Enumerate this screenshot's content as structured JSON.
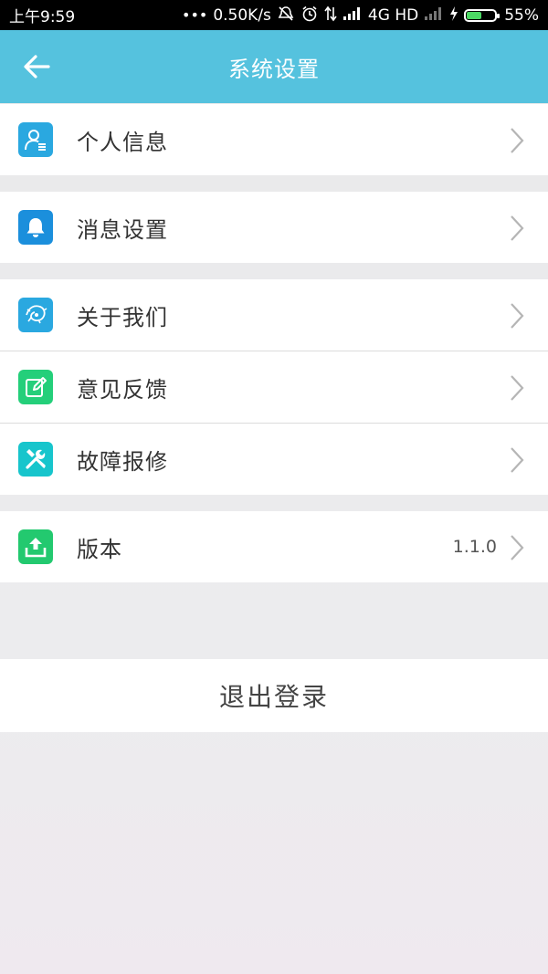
{
  "status_bar": {
    "time": "上午9:59",
    "network_speed": "0.50K/s",
    "network_type": "4G HD",
    "battery_percent": "55%",
    "battery_level": 0.55
  },
  "app_bar": {
    "title": "系统设置",
    "back_icon": "arrow-left-icon"
  },
  "groups": [
    {
      "items": [
        {
          "label": "个人信息",
          "icon": "user-profile-icon",
          "icon_color": "#2aa8e0",
          "value": ""
        }
      ]
    },
    {
      "items": [
        {
          "label": "消息设置",
          "icon": "bell-icon",
          "icon_color": "#1b8fdc",
          "value": ""
        }
      ]
    },
    {
      "items": [
        {
          "label": "关于我们",
          "icon": "about-logo-icon",
          "icon_color": "#2aa8e0",
          "value": ""
        },
        {
          "label": "意见反馈",
          "icon": "edit-feedback-icon",
          "icon_color": "#24cf7a",
          "value": ""
        },
        {
          "label": "故障报修",
          "icon": "repair-tools-icon",
          "icon_color": "#17c5cc",
          "value": ""
        }
      ]
    },
    {
      "items": [
        {
          "label": "版本",
          "icon": "upload-update-icon",
          "icon_color": "#23c96f",
          "value": "1.1.0"
        }
      ]
    }
  ],
  "logout_label": "退出登录",
  "colors": {
    "app_bar": "#55c2de",
    "background": "#e9e9ea",
    "chevron": "#b5b5b5"
  }
}
